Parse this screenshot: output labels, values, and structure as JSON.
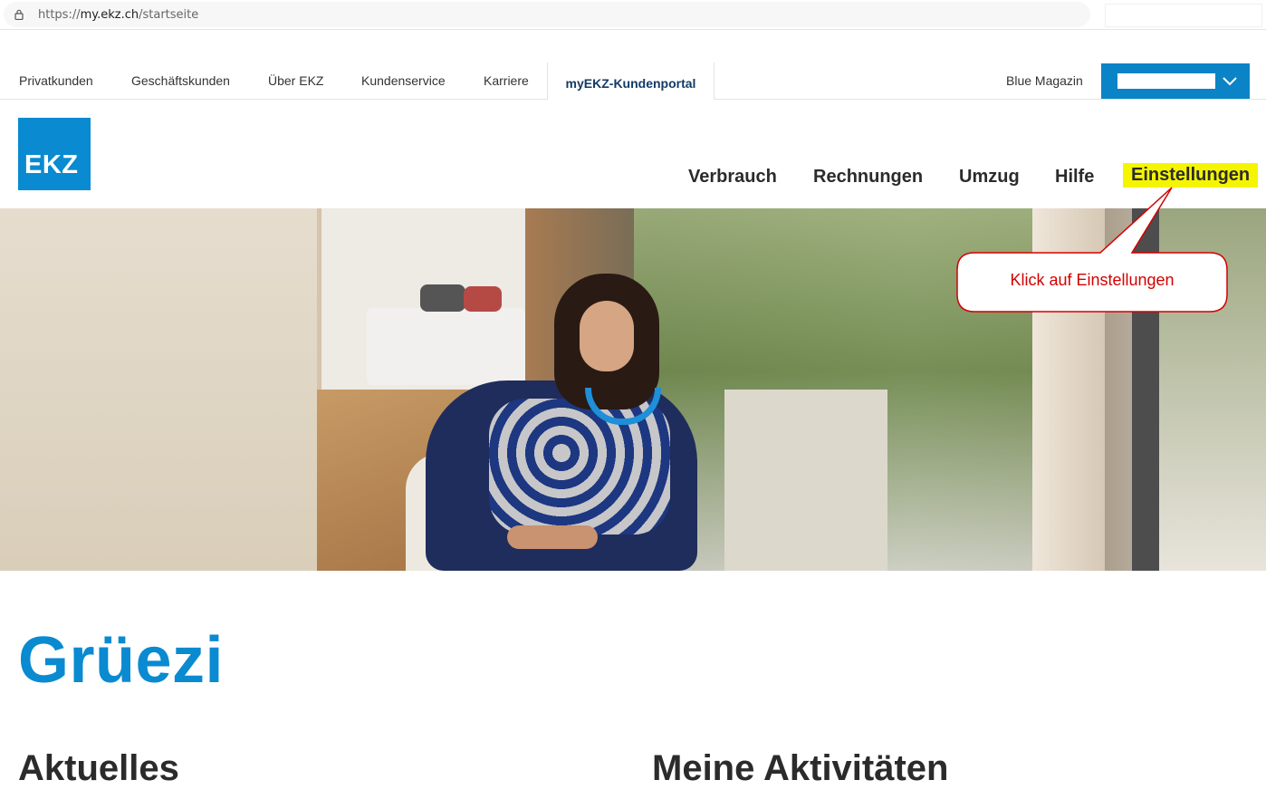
{
  "browser": {
    "url_scheme": "https://",
    "url_host": "my.ekz.ch",
    "url_path": "/startseite"
  },
  "topnav": {
    "items": [
      "Privatkunden",
      "Geschäftskunden",
      "Über EKZ",
      "Kundenservice",
      "Karriere"
    ],
    "active_tab": "myEKZ-Kundenportal",
    "blue_magazin": "Blue Magazin"
  },
  "logo": {
    "text": "EKZ"
  },
  "mainnav": {
    "items": [
      "Verbrauch",
      "Rechnungen",
      "Umzug",
      "Hilfe"
    ],
    "highlighted": "Einstellungen"
  },
  "callout": {
    "text": "Klick auf Einstellungen"
  },
  "content": {
    "greeting": "Grüezi",
    "section_left": "Aktuelles",
    "section_right": "Meine Aktivitäten"
  },
  "colors": {
    "brand_blue": "#0a8ad0",
    "highlight_yellow": "#f5f500",
    "callout_red": "#d40000"
  }
}
